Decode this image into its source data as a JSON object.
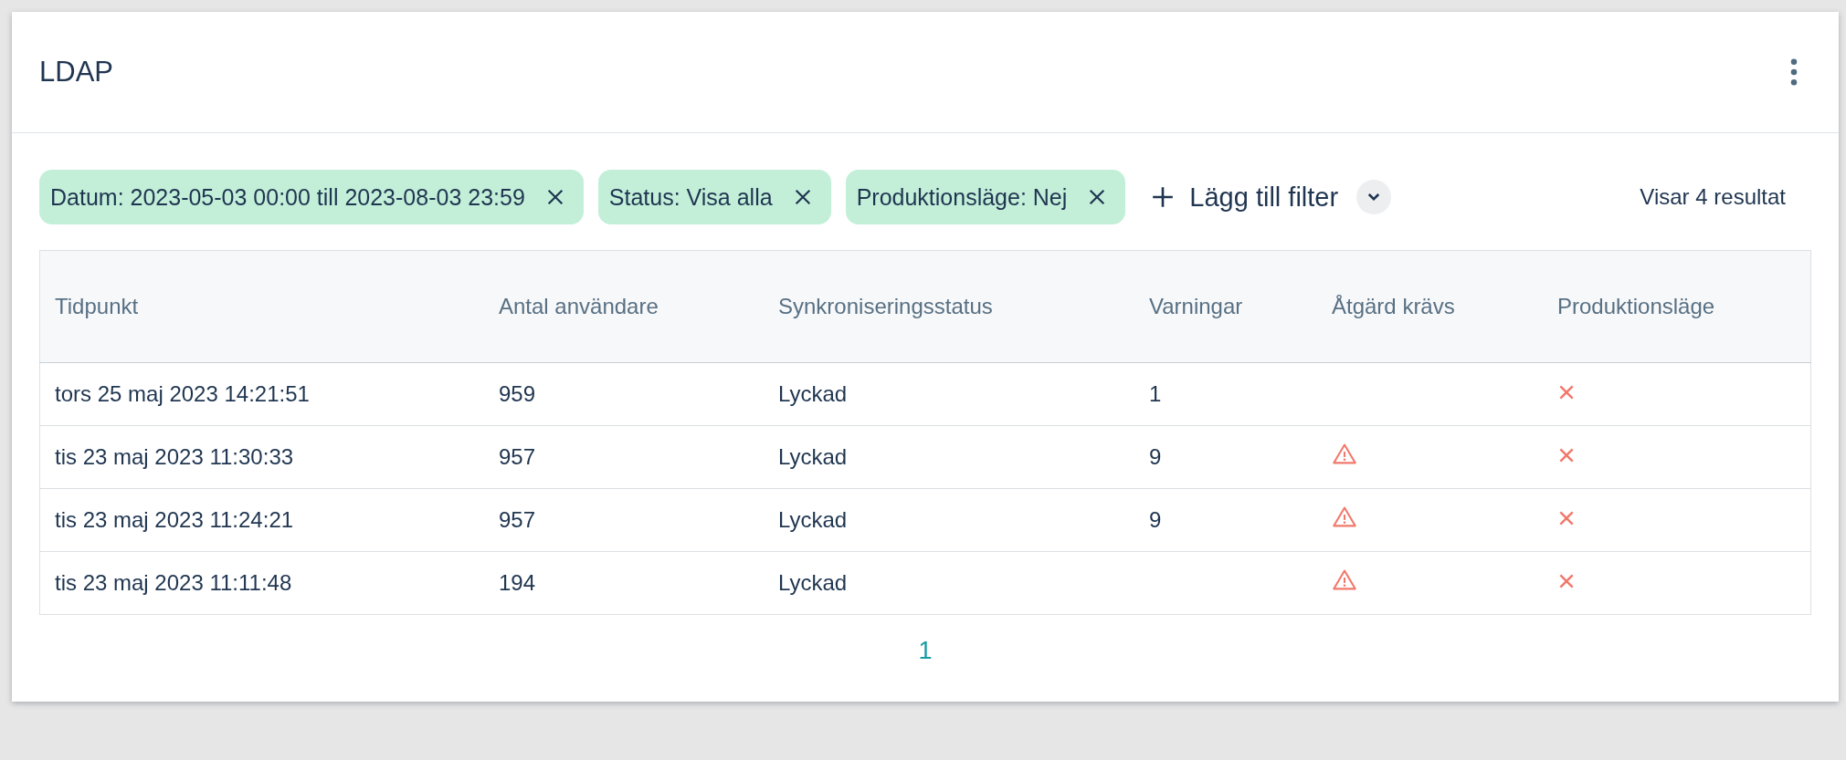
{
  "title": "LDAP",
  "filters": [
    {
      "label": "Datum: 2023-05-03 00:00 till 2023-08-03 23:59"
    },
    {
      "label": "Status: Visa alla"
    },
    {
      "label": "Produktionsläge: Nej"
    }
  ],
  "add_filter": {
    "label": "Lägg till filter"
  },
  "result_count": "Visar 4 resultat",
  "table": {
    "columns": [
      "Tidpunkt",
      "Antal användare",
      "Synkroniseringsstatus",
      "Varningar",
      "Åtgärd krävs",
      "Produktionsläge"
    ],
    "rows": [
      {
        "time": "tors 25 maj 2023 14:21:51",
        "users": "959",
        "status": "Lyckad",
        "warnings": "1",
        "action_required": false,
        "production_mode": false
      },
      {
        "time": "tis 23 maj 2023 11:30:33",
        "users": "957",
        "status": "Lyckad",
        "warnings": "9",
        "action_required": true,
        "production_mode": false
      },
      {
        "time": "tis 23 maj 2023 11:24:21",
        "users": "957",
        "status": "Lyckad",
        "warnings": "9",
        "action_required": true,
        "production_mode": false
      },
      {
        "time": "tis 23 maj 2023 11:11:48",
        "users": "194",
        "status": "Lyckad",
        "warnings": "",
        "action_required": true,
        "production_mode": false
      }
    ]
  },
  "pagination": [
    {
      "label": "1",
      "selected": true
    }
  ]
}
